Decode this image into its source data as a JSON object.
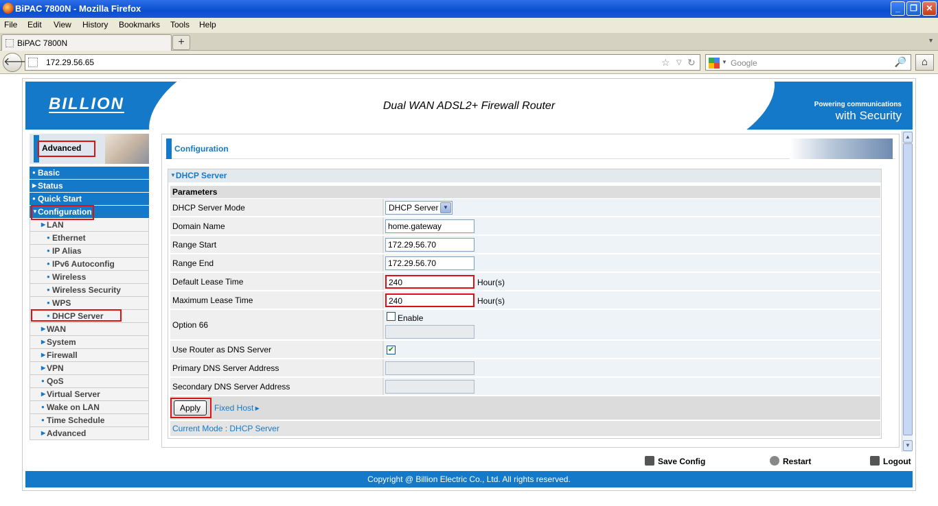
{
  "window": {
    "title": "BiPAC 7800N - Mozilla Firefox"
  },
  "menu": [
    "File",
    "Edit",
    "View",
    "History",
    "Bookmarks",
    "Tools",
    "Help"
  ],
  "tab": {
    "title": "BiPAC 7800N",
    "new_tab": "+"
  },
  "address": {
    "url": "172.29.56.65"
  },
  "search": {
    "placeholder": "Google"
  },
  "banner": {
    "logo": "BILLION",
    "title": "Dual WAN ADSL2+ Firewall Router",
    "powering_line1": "Powering communications",
    "powering_line2": "with Security"
  },
  "left": {
    "mode_label": "Advanced",
    "top_items": [
      {
        "label": "Basic"
      },
      {
        "label": "Status"
      },
      {
        "label": "Quick Start"
      },
      {
        "label": "Configuration"
      }
    ],
    "config_items": [
      {
        "label": "LAN",
        "level": 1,
        "marker": "arrow"
      },
      {
        "label": "Ethernet",
        "level": 2
      },
      {
        "label": "IP Alias",
        "level": 2
      },
      {
        "label": "IPv6 Autoconfig",
        "level": 2
      },
      {
        "label": "Wireless",
        "level": 2
      },
      {
        "label": "Wireless Security",
        "level": 2
      },
      {
        "label": "WPS",
        "level": 2
      },
      {
        "label": "DHCP Server",
        "level": 2
      },
      {
        "label": "WAN",
        "level": 1,
        "marker": "arrow"
      },
      {
        "label": "System",
        "level": 1,
        "marker": "arrow"
      },
      {
        "label": "Firewall",
        "level": 1,
        "marker": "arrow"
      },
      {
        "label": "VPN",
        "level": 1,
        "marker": "arrow"
      },
      {
        "label": "QoS",
        "level": 1,
        "marker": "dot"
      },
      {
        "label": "Virtual Server",
        "level": 1,
        "marker": "arrow"
      },
      {
        "label": "Wake on LAN",
        "level": 1,
        "marker": "dot"
      },
      {
        "label": "Time Schedule",
        "level": 1,
        "marker": "dot"
      },
      {
        "label": "Advanced",
        "level": 1,
        "marker": "arrow"
      }
    ]
  },
  "main": {
    "section_title": "Configuration",
    "panel_title": "DHCP Server",
    "params_label": "Parameters",
    "rows": {
      "mode": {
        "label": "DHCP Server Mode",
        "value": "DHCP Server"
      },
      "domain": {
        "label": "Domain Name",
        "value": "home.gateway"
      },
      "range_start": {
        "label": "Range Start",
        "value": "172.29.56.70"
      },
      "range_end": {
        "label": "Range End",
        "value": "172.29.56.70"
      },
      "default_lease": {
        "label": "Default Lease Time",
        "value": "240",
        "unit": "Hour(s)"
      },
      "max_lease": {
        "label": "Maximum Lease Time",
        "value": "240",
        "unit": "Hour(s)"
      },
      "option66": {
        "label": "Option 66",
        "checkbox_label": "Enable",
        "checked": false,
        "value": ""
      },
      "use_dns": {
        "label": "Use Router as DNS Server",
        "checked": true
      },
      "primary_dns": {
        "label": "Primary DNS Server Address",
        "value": ""
      },
      "secondary_dns": {
        "label": "Secondary DNS Server Address",
        "value": ""
      }
    },
    "apply_label": "Apply",
    "fixed_host_label": "Fixed Host",
    "current_mode": "Current Mode : DHCP Server"
  },
  "bottom": {
    "save": "Save Config",
    "restart": "Restart",
    "logout": "Logout",
    "copyright": "Copyright @ Billion Electric Co., Ltd. All rights reserved."
  },
  "colors": {
    "accent": "#1479c8",
    "highlight": "#dd1111"
  }
}
